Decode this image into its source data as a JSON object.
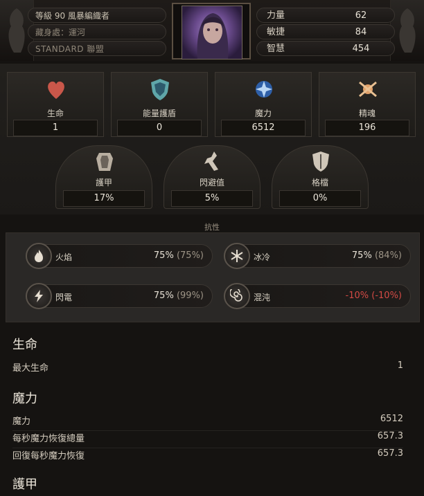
{
  "header": {
    "level_class": "等級 90 風暴編織者",
    "hideout": "藏身處：運河",
    "league": "STANDARD 聯盟"
  },
  "attributes": [
    {
      "label": "力量",
      "value": "62"
    },
    {
      "label": "敏捷",
      "value": "84"
    },
    {
      "label": "智慧",
      "value": "454"
    }
  ],
  "pools": [
    {
      "name": "生命",
      "value": "1",
      "icon": "heart-icon"
    },
    {
      "name": "能量護盾",
      "value": "0",
      "icon": "energy-shield-icon"
    },
    {
      "name": "魔力",
      "value": "6512",
      "icon": "mana-icon"
    },
    {
      "name": "精魂",
      "value": "196",
      "icon": "spirit-icon"
    }
  ],
  "defences": [
    {
      "name": "護甲",
      "value": "17%",
      "icon": "armour-icon"
    },
    {
      "name": "閃避值",
      "value": "5%",
      "icon": "evasion-icon"
    },
    {
      "name": "格檔",
      "value": "0%",
      "icon": "block-icon"
    }
  ],
  "resistances": {
    "title": "抗性",
    "items": [
      {
        "name": "火焰",
        "value": "75%",
        "max": "(75%)",
        "icon": "fire-icon"
      },
      {
        "name": "冰冷",
        "value": "75%",
        "max": "(84%)",
        "icon": "cold-icon"
      },
      {
        "name": "閃電",
        "value": "75%",
        "max": "(99%)",
        "icon": "lightning-icon"
      },
      {
        "name": "混沌",
        "value": "-10%",
        "max": "(-10%)",
        "icon": "chaos-icon"
      }
    ]
  },
  "sections": {
    "life": {
      "title": "生命",
      "rows": [
        {
          "label": "最大生命",
          "value": "1"
        }
      ]
    },
    "mana": {
      "title": "魔力",
      "rows": [
        {
          "label": "魔力",
          "value": "6512"
        },
        {
          "label": "每秒魔力恢復總量",
          "value": "657.3"
        },
        {
          "label": "回復每秒魔力恢復",
          "value": "657.3"
        }
      ]
    },
    "armour": {
      "title": "護甲"
    }
  },
  "colors": {
    "background": "#151311",
    "negative": "#d44a45",
    "text": "#d9d2c5"
  }
}
